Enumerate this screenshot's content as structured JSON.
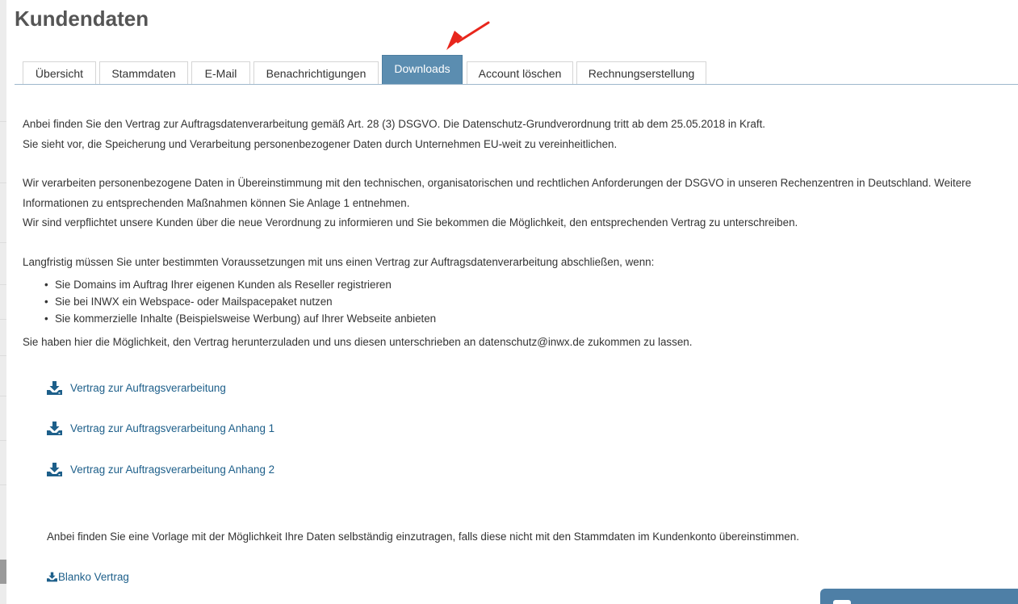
{
  "page": {
    "title": "Kundendaten"
  },
  "tabs": [
    {
      "label": "Übersicht",
      "active": false
    },
    {
      "label": "Stammdaten",
      "active": false
    },
    {
      "label": "E-Mail",
      "active": false
    },
    {
      "label": "Benachrichtigungen",
      "active": false
    },
    {
      "label": "Downloads",
      "active": true
    },
    {
      "label": "Account löschen",
      "active": false
    },
    {
      "label": "Rechnungserstellung",
      "active": false
    }
  ],
  "content": {
    "p1_line1": "Anbei finden Sie den Vertrag zur Auftragsdatenverarbeitung gemäß Art. 28 (3) DSGVO. Die Datenschutz-Grundverordnung tritt ab dem 25.05.2018 in Kraft.",
    "p1_line2": "Sie sieht vor, die Speicherung und Verarbeitung personenbezogener Daten durch Unternehmen EU-weit zu vereinheitlichen.",
    "p2_line1": "Wir verarbeiten personenbezogene Daten in Übereinstimmung mit den technischen, organisatorischen und rechtlichen Anforderungen der DSGVO in unseren Rechenzentren in Deutschland. Weitere",
    "p2_line2": "Informationen zu entsprechenden Maßnahmen können Sie Anlage 1 entnehmen.",
    "p2_line3": "Wir sind verpflichtet unsere Kunden über die neue Verordnung zu informieren und Sie bekommen die Möglichkeit, den entsprechenden Vertrag zu unterschreiben.",
    "p3": "Langfristig müssen Sie unter bestimmten Voraussetzungen mit uns einen Vertrag zur Auftragsdatenverarbeitung abschließen, wenn:",
    "bullets": [
      "Sie Domains im Auftrag Ihrer eigenen Kunden als Reseller registrieren",
      "Sie bei INWX ein Webspace- oder Mailspacepaket nutzen",
      "Sie kommerzielle Inhalte (Beispielsweise Werbung) auf Ihrer Webseite anbieten"
    ],
    "p4": "Sie haben hier die Möglichkeit, den Vertrag herunterzuladen und uns diesen unterschrieben an datenschutz@inwx.de zukommen zu lassen."
  },
  "downloads": [
    {
      "label": "Vertrag zur Auftragsverarbeitung",
      "icon": "download-icon"
    },
    {
      "label": "Vertrag zur Auftragsverarbeitung Anhang 1",
      "icon": "download-icon"
    },
    {
      "label": "Vertrag zur Auftragsverarbeitung Anhang 2",
      "icon": "download-icon"
    }
  ],
  "template_note": "Anbei finden Sie eine Vorlage mit der Möglichkeit Ihre Daten selbständig einzutragen, falls diese nicht mit den Stammdaten im Kundenkonto übereinstimmen.",
  "blank_download": {
    "label": "Blanko Vertrag",
    "icon": "download-icon"
  },
  "colors": {
    "accent": "#5b8db0",
    "link": "#1d5f8a",
    "annotation_arrow": "#e8261c",
    "chat_widget": "#4e7fa6"
  }
}
